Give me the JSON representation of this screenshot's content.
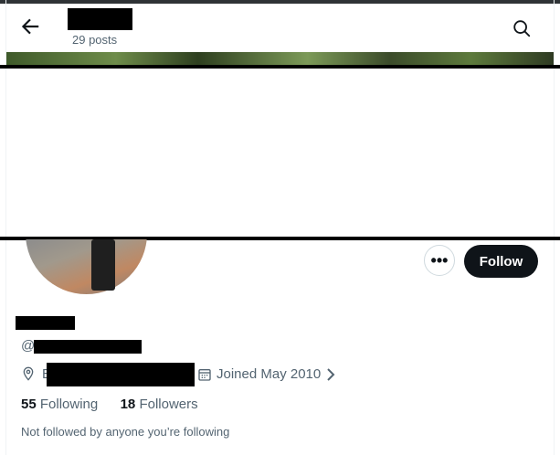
{
  "header": {
    "posts_count": "29 posts"
  },
  "actions": {
    "more_label": "•••",
    "follow_label": "Follow"
  },
  "profile": {
    "handle_prefix": "@",
    "location_initial": "E",
    "joined": "Joined May 2010",
    "following_count": "55",
    "following_label": "Following",
    "followers_count": "18",
    "followers_label": "Followers",
    "mutual_note": "Not followed by anyone you’re following"
  },
  "icons": {
    "back": "arrow-left-icon",
    "search": "search-icon",
    "location": "map-pin-icon",
    "calendar": "calendar-icon",
    "chevron": "chevron-right-icon"
  },
  "colors": {
    "follow_button_bg": "#0f1419",
    "secondary_text": "#536471"
  }
}
